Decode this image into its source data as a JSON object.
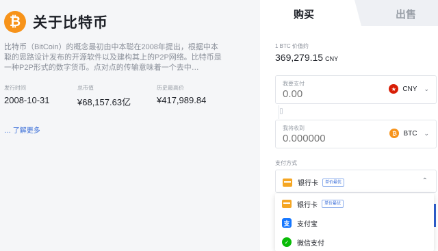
{
  "coin": {
    "logo_symbol": "₿",
    "title": "关于比特币",
    "description": "比特币（BitCoin）的概念最初由中本聪在2008年提出，根据中本聪的思路设计发布的开源软件以及建构其上的P2P网络。比特币是一种P2P形式的数字货币。点对点的传输意味着一个去中…",
    "stats": [
      {
        "label": "发行时间",
        "value": "2008-10-31"
      },
      {
        "label": "总市值",
        "value": "¥68,157.63亿"
      },
      {
        "label": "历史最高价",
        "value": "¥417,989.84"
      }
    ],
    "learn_more": "… 了解更多"
  },
  "tabs": {
    "buy": "购买",
    "sell": "出售"
  },
  "price": {
    "label": "1 BTC 价值约",
    "value": "369,279.15",
    "unit": "CNY"
  },
  "pay_field": {
    "label": "我要支付",
    "placeholder": "0.00",
    "currency": "CNY",
    "currency_icon": "cny-flag-icon"
  },
  "receive_field": {
    "label": "我将收到",
    "placeholder": "0.000000",
    "currency": "BTC",
    "currency_icon": "btc-icon"
  },
  "payment": {
    "label": "支付方式",
    "selected": {
      "name": "银行卡",
      "badge": "单价最优"
    },
    "options": [
      {
        "name": "银行卡",
        "badge": "单价最优",
        "icon": "bank-card-icon"
      },
      {
        "name": "支付宝",
        "icon": "alipay-icon"
      },
      {
        "name": "微信支付",
        "icon": "wechat-pay-icon"
      }
    ]
  },
  "colors": {
    "accent": "#3a6ed8",
    "btc": "#f7931a",
    "cny": "#d81e06"
  }
}
